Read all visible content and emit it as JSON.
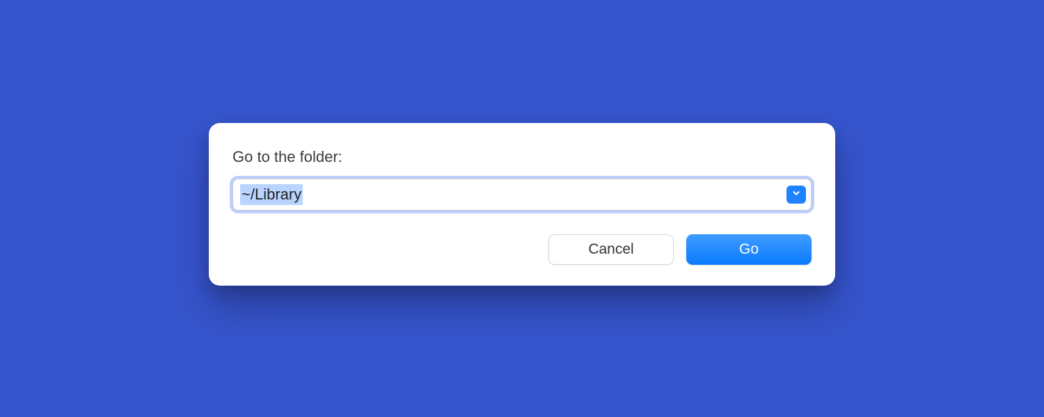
{
  "dialog": {
    "label": "Go to the folder:",
    "path_value": "~/Library",
    "dropdown_icon": "chevron-down",
    "buttons": {
      "cancel": "Cancel",
      "go": "Go"
    }
  },
  "colors": {
    "background": "#3654cc",
    "accent": "#1f82ff",
    "selection": "#b8d4ff"
  }
}
